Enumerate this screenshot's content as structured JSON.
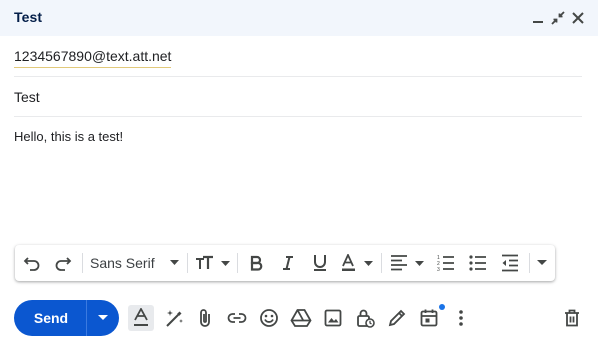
{
  "window": {
    "title": "Test"
  },
  "recipient": {
    "address": "1234567890@text.att.net"
  },
  "subject": {
    "value": "Test"
  },
  "message": {
    "body": "Hello, this is a test!"
  },
  "format_toolbar": {
    "font_family": "Sans Serif"
  },
  "actions": {
    "send_label": "Send"
  },
  "colors": {
    "send_button": "#0b57d0",
    "title_bar": "#f2f6fc",
    "title_text": "#041e49",
    "icon": "#444746",
    "notification_dot": "#1a73e8"
  },
  "icons": {
    "title_bar": [
      "minimize-icon",
      "exit-fullscreen-icon",
      "close-icon"
    ],
    "format_toolbar": [
      "undo-icon",
      "redo-icon",
      "font-family-dropdown",
      "text-size-icon",
      "bold-icon",
      "italic-icon",
      "underline-icon",
      "text-color-icon",
      "align-icon",
      "numbered-list-icon",
      "bulleted-list-icon",
      "indent-less-icon",
      "more-formatting-icon"
    ],
    "bottom_toolbar": [
      "formatting-options-icon",
      "magic-write-icon",
      "attach-icon",
      "link-icon",
      "emoji-icon",
      "drive-icon",
      "photo-icon",
      "confidential-mode-icon",
      "signature-icon",
      "schedule-send-icon",
      "more-options-icon",
      "discard-icon"
    ]
  }
}
